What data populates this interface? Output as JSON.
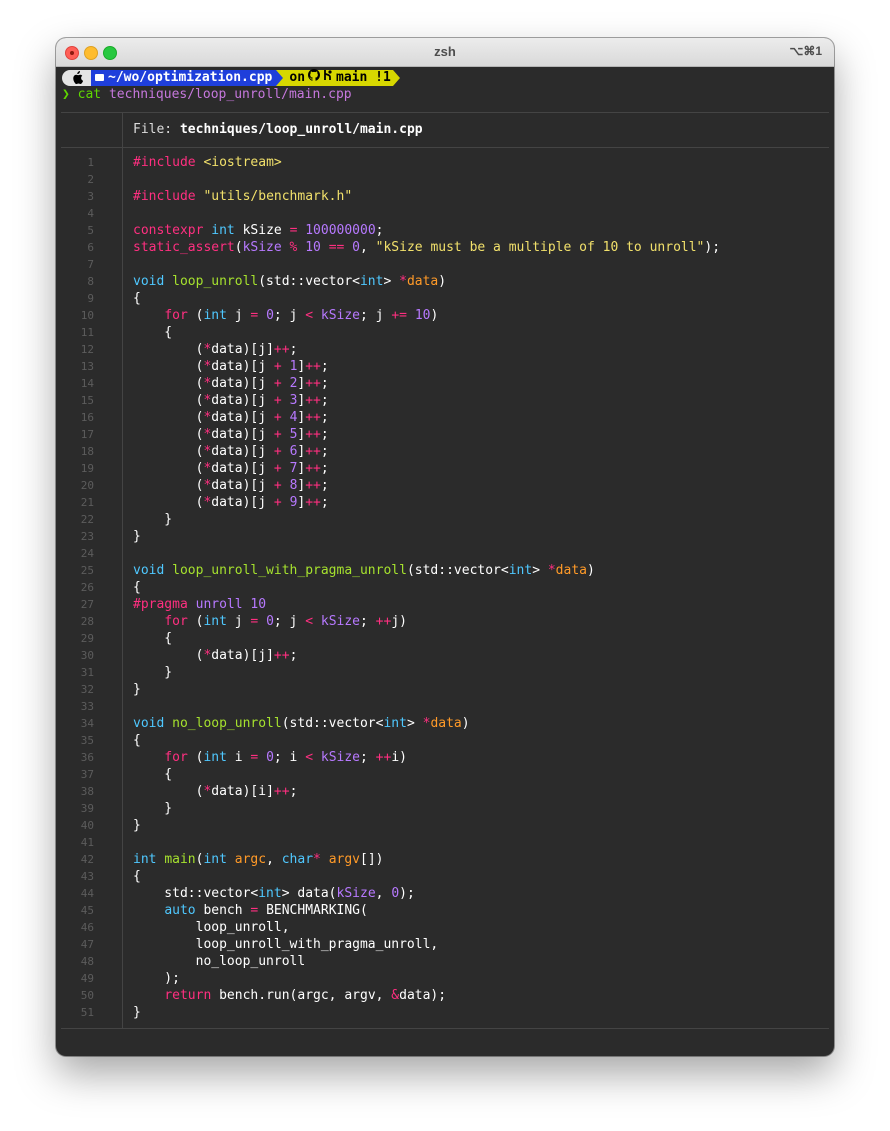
{
  "window": {
    "title": "zsh",
    "shortcut": "⌥⌘1"
  },
  "prompt": {
    "os_icon": "apple-icon",
    "dir_prefix": "~/wo/",
    "dir_name": "optimization.cpp",
    "git_label": "on",
    "branch": "main",
    "status": "!1",
    "colors": {
      "dir": "#1f3fdb",
      "git": "#d7d700",
      "os": "#e4e4e4"
    }
  },
  "command": {
    "caret": "❯",
    "cmd": "cat",
    "arg": "techniques/loop_unroll/main.cpp"
  },
  "file_header": {
    "label": "File:",
    "path": "techniques/loop_unroll/main.cpp"
  },
  "code_lines": [
    [
      [
        "k",
        "#include"
      ],
      [
        "w",
        " "
      ],
      [
        "s",
        "<iostream>"
      ]
    ],
    [],
    [
      [
        "k",
        "#include"
      ],
      [
        "w",
        " "
      ],
      [
        "s",
        "\"utils/benchmark.h\""
      ]
    ],
    [],
    [
      [
        "k",
        "constexpr"
      ],
      [
        "w",
        " "
      ],
      [
        "t",
        "int"
      ],
      [
        "w",
        " kSize "
      ],
      [
        "o",
        "="
      ],
      [
        "w",
        " "
      ],
      [
        "n",
        "100000000"
      ],
      [
        "w",
        ";"
      ]
    ],
    [
      [
        "k",
        "static_assert"
      ],
      [
        "w",
        "("
      ],
      [
        "n",
        "kSize"
      ],
      [
        "w",
        " "
      ],
      [
        "o",
        "%"
      ],
      [
        "w",
        " "
      ],
      [
        "n",
        "10"
      ],
      [
        "w",
        " "
      ],
      [
        "o",
        "=="
      ],
      [
        "w",
        " "
      ],
      [
        "n",
        "0"
      ],
      [
        "w",
        ", "
      ],
      [
        "s",
        "\"kSize must be a multiple of 10 to unroll\""
      ],
      [
        "w",
        ");"
      ]
    ],
    [],
    [
      [
        "t",
        "void"
      ],
      [
        "w",
        " "
      ],
      [
        "f",
        "loop_unroll"
      ],
      [
        "w",
        "(std::vector<"
      ],
      [
        "t",
        "int"
      ],
      [
        "w",
        "> "
      ],
      [
        "o",
        "*"
      ],
      [
        "p",
        "data"
      ],
      [
        "w",
        ")"
      ]
    ],
    [
      [
        "w",
        "{"
      ]
    ],
    [
      [
        "w",
        "    "
      ],
      [
        "k",
        "for"
      ],
      [
        "w",
        " ("
      ],
      [
        "t",
        "int"
      ],
      [
        "w",
        " j "
      ],
      [
        "o",
        "="
      ],
      [
        "w",
        " "
      ],
      [
        "n",
        "0"
      ],
      [
        "w",
        "; j "
      ],
      [
        "o",
        "<"
      ],
      [
        "w",
        " "
      ],
      [
        "n",
        "kSize"
      ],
      [
        "w",
        "; j "
      ],
      [
        "o",
        "+="
      ],
      [
        "w",
        " "
      ],
      [
        "n",
        "10"
      ],
      [
        "w",
        ")"
      ]
    ],
    [
      [
        "w",
        "    {"
      ]
    ],
    [
      [
        "w",
        "        ("
      ],
      [
        "o",
        "*"
      ],
      [
        "w",
        "data)[j]"
      ],
      [
        "o",
        "++"
      ],
      [
        "w",
        ";"
      ]
    ],
    [
      [
        "w",
        "        ("
      ],
      [
        "o",
        "*"
      ],
      [
        "w",
        "data)[j "
      ],
      [
        "o",
        "+"
      ],
      [
        "w",
        " "
      ],
      [
        "n",
        "1"
      ],
      [
        "w",
        "]"
      ],
      [
        "o",
        "++"
      ],
      [
        "w",
        ";"
      ]
    ],
    [
      [
        "w",
        "        ("
      ],
      [
        "o",
        "*"
      ],
      [
        "w",
        "data)[j "
      ],
      [
        "o",
        "+"
      ],
      [
        "w",
        " "
      ],
      [
        "n",
        "2"
      ],
      [
        "w",
        "]"
      ],
      [
        "o",
        "++"
      ],
      [
        "w",
        ";"
      ]
    ],
    [
      [
        "w",
        "        ("
      ],
      [
        "o",
        "*"
      ],
      [
        "w",
        "data)[j "
      ],
      [
        "o",
        "+"
      ],
      [
        "w",
        " "
      ],
      [
        "n",
        "3"
      ],
      [
        "w",
        "]"
      ],
      [
        "o",
        "++"
      ],
      [
        "w",
        ";"
      ]
    ],
    [
      [
        "w",
        "        ("
      ],
      [
        "o",
        "*"
      ],
      [
        "w",
        "data)[j "
      ],
      [
        "o",
        "+"
      ],
      [
        "w",
        " "
      ],
      [
        "n",
        "4"
      ],
      [
        "w",
        "]"
      ],
      [
        "o",
        "++"
      ],
      [
        "w",
        ";"
      ]
    ],
    [
      [
        "w",
        "        ("
      ],
      [
        "o",
        "*"
      ],
      [
        "w",
        "data)[j "
      ],
      [
        "o",
        "+"
      ],
      [
        "w",
        " "
      ],
      [
        "n",
        "5"
      ],
      [
        "w",
        "]"
      ],
      [
        "o",
        "++"
      ],
      [
        "w",
        ";"
      ]
    ],
    [
      [
        "w",
        "        ("
      ],
      [
        "o",
        "*"
      ],
      [
        "w",
        "data)[j "
      ],
      [
        "o",
        "+"
      ],
      [
        "w",
        " "
      ],
      [
        "n",
        "6"
      ],
      [
        "w",
        "]"
      ],
      [
        "o",
        "++"
      ],
      [
        "w",
        ";"
      ]
    ],
    [
      [
        "w",
        "        ("
      ],
      [
        "o",
        "*"
      ],
      [
        "w",
        "data)[j "
      ],
      [
        "o",
        "+"
      ],
      [
        "w",
        " "
      ],
      [
        "n",
        "7"
      ],
      [
        "w",
        "]"
      ],
      [
        "o",
        "++"
      ],
      [
        "w",
        ";"
      ]
    ],
    [
      [
        "w",
        "        ("
      ],
      [
        "o",
        "*"
      ],
      [
        "w",
        "data)[j "
      ],
      [
        "o",
        "+"
      ],
      [
        "w",
        " "
      ],
      [
        "n",
        "8"
      ],
      [
        "w",
        "]"
      ],
      [
        "o",
        "++"
      ],
      [
        "w",
        ";"
      ]
    ],
    [
      [
        "w",
        "        ("
      ],
      [
        "o",
        "*"
      ],
      [
        "w",
        "data)[j "
      ],
      [
        "o",
        "+"
      ],
      [
        "w",
        " "
      ],
      [
        "n",
        "9"
      ],
      [
        "w",
        "]"
      ],
      [
        "o",
        "++"
      ],
      [
        "w",
        ";"
      ]
    ],
    [
      [
        "w",
        "    }"
      ]
    ],
    [
      [
        "w",
        "}"
      ]
    ],
    [],
    [
      [
        "t",
        "void"
      ],
      [
        "w",
        " "
      ],
      [
        "f",
        "loop_unroll_with_pragma_unroll"
      ],
      [
        "w",
        "(std::vector<"
      ],
      [
        "t",
        "int"
      ],
      [
        "w",
        "> "
      ],
      [
        "o",
        "*"
      ],
      [
        "p",
        "data"
      ],
      [
        "w",
        ")"
      ]
    ],
    [
      [
        "w",
        "{"
      ]
    ],
    [
      [
        "k",
        "#pragma"
      ],
      [
        "w",
        " "
      ],
      [
        "n",
        "unroll"
      ],
      [
        "w",
        " "
      ],
      [
        "n",
        "10"
      ]
    ],
    [
      [
        "w",
        "    "
      ],
      [
        "k",
        "for"
      ],
      [
        "w",
        " ("
      ],
      [
        "t",
        "int"
      ],
      [
        "w",
        " j "
      ],
      [
        "o",
        "="
      ],
      [
        "w",
        " "
      ],
      [
        "n",
        "0"
      ],
      [
        "w",
        "; j "
      ],
      [
        "o",
        "<"
      ],
      [
        "w",
        " "
      ],
      [
        "n",
        "kSize"
      ],
      [
        "w",
        "; "
      ],
      [
        "o",
        "++"
      ],
      [
        "w",
        "j)"
      ]
    ],
    [
      [
        "w",
        "    {"
      ]
    ],
    [
      [
        "w",
        "        ("
      ],
      [
        "o",
        "*"
      ],
      [
        "w",
        "data)[j]"
      ],
      [
        "o",
        "++"
      ],
      [
        "w",
        ";"
      ]
    ],
    [
      [
        "w",
        "    }"
      ]
    ],
    [
      [
        "w",
        "}"
      ]
    ],
    [],
    [
      [
        "t",
        "void"
      ],
      [
        "w",
        " "
      ],
      [
        "f",
        "no_loop_unroll"
      ],
      [
        "w",
        "(std::vector<"
      ],
      [
        "t",
        "int"
      ],
      [
        "w",
        "> "
      ],
      [
        "o",
        "*"
      ],
      [
        "p",
        "data"
      ],
      [
        "w",
        ")"
      ]
    ],
    [
      [
        "w",
        "{"
      ]
    ],
    [
      [
        "w",
        "    "
      ],
      [
        "k",
        "for"
      ],
      [
        "w",
        " ("
      ],
      [
        "t",
        "int"
      ],
      [
        "w",
        " i "
      ],
      [
        "o",
        "="
      ],
      [
        "w",
        " "
      ],
      [
        "n",
        "0"
      ],
      [
        "w",
        "; i "
      ],
      [
        "o",
        "<"
      ],
      [
        "w",
        " "
      ],
      [
        "n",
        "kSize"
      ],
      [
        "w",
        "; "
      ],
      [
        "o",
        "++"
      ],
      [
        "w",
        "i)"
      ]
    ],
    [
      [
        "w",
        "    {"
      ]
    ],
    [
      [
        "w",
        "        ("
      ],
      [
        "o",
        "*"
      ],
      [
        "w",
        "data)[i]"
      ],
      [
        "o",
        "++"
      ],
      [
        "w",
        ";"
      ]
    ],
    [
      [
        "w",
        "    }"
      ]
    ],
    [
      [
        "w",
        "}"
      ]
    ],
    [],
    [
      [
        "t",
        "int"
      ],
      [
        "w",
        " "
      ],
      [
        "f",
        "main"
      ],
      [
        "w",
        "("
      ],
      [
        "t",
        "int"
      ],
      [
        "w",
        " "
      ],
      [
        "p",
        "argc"
      ],
      [
        "w",
        ", "
      ],
      [
        "t",
        "char"
      ],
      [
        "o",
        "*"
      ],
      [
        "w",
        " "
      ],
      [
        "p",
        "argv"
      ],
      [
        "w",
        "[])"
      ]
    ],
    [
      [
        "w",
        "{"
      ]
    ],
    [
      [
        "w",
        "    std::vector<"
      ],
      [
        "t",
        "int"
      ],
      [
        "w",
        "> data("
      ],
      [
        "n",
        "kSize"
      ],
      [
        "w",
        ", "
      ],
      [
        "n",
        "0"
      ],
      [
        "w",
        ");"
      ]
    ],
    [
      [
        "w",
        "    "
      ],
      [
        "t",
        "auto"
      ],
      [
        "w",
        " bench "
      ],
      [
        "o",
        "="
      ],
      [
        "w",
        " BENCHMARKING("
      ]
    ],
    [
      [
        "w",
        "        loop_unroll,"
      ]
    ],
    [
      [
        "w",
        "        loop_unroll_with_pragma_unroll,"
      ]
    ],
    [
      [
        "w",
        "        no_loop_unroll"
      ]
    ],
    [
      [
        "w",
        "    );"
      ]
    ],
    [
      [
        "w",
        "    "
      ],
      [
        "k",
        "return"
      ],
      [
        "w",
        " bench.run(argc, argv, "
      ],
      [
        "o",
        "&"
      ],
      [
        "w",
        "data);"
      ]
    ],
    [
      [
        "w",
        "}"
      ]
    ]
  ]
}
